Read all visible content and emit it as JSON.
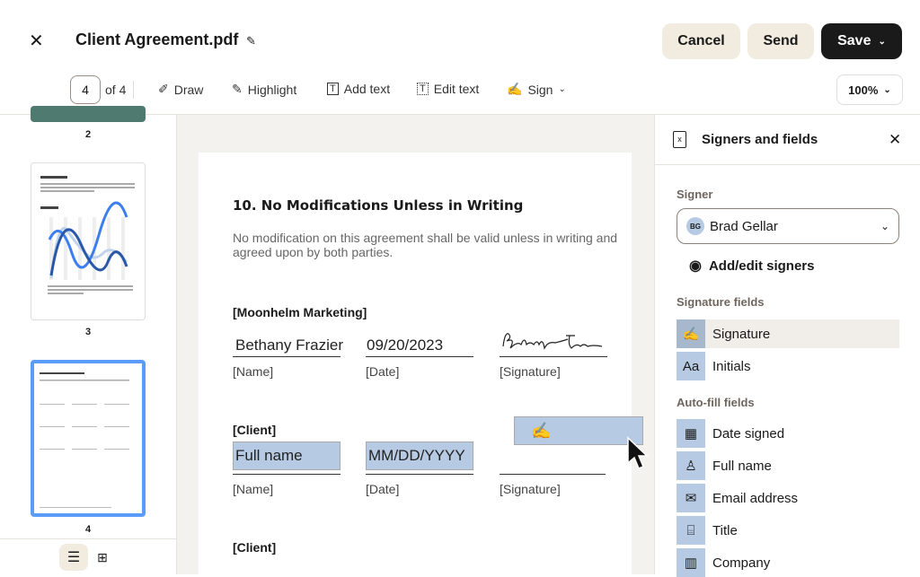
{
  "header": {
    "title": "Client Agreement.pdf",
    "cancel": "Cancel",
    "send": "Send",
    "save": "Save"
  },
  "toolbar": {
    "page": "4",
    "of": "of 4",
    "draw": "Draw",
    "highlight": "Highlight",
    "add_text": "Add text",
    "edit_text": "Edit text",
    "sign": "Sign",
    "zoom": "100%"
  },
  "thumbnails": {
    "labels": [
      "2",
      "3",
      "4"
    ],
    "current": "4"
  },
  "document": {
    "heading": "10. No Modifications Unless in Writing",
    "body": "No modification on this agreement shall be valid unless in writing and agreed upon by both parties.",
    "party1": "[Moonhelm Marketing]",
    "name1": "Bethany Frazier",
    "date1": "09/20/2023",
    "party2": "[Client]",
    "name_field": "Full name",
    "date_field": "MM/DD/YYYY",
    "party3": "[Client]",
    "name_label": "[Name]",
    "date_label": "[Date]",
    "sig_label": "[Signature]"
  },
  "panel": {
    "title": "Signers and fields",
    "signer_label": "Signer",
    "signer_initials": "BG",
    "signer_name": "Brad Gellar",
    "add_edit": "Add/edit signers",
    "sig_section": "Signature fields",
    "sig_fields": [
      "Signature",
      "Initials"
    ],
    "auto_section": "Auto-fill fields",
    "auto_fields": [
      "Date signed",
      "Full name",
      "Email address",
      "Title",
      "Company"
    ]
  },
  "colors": {
    "field": "#b7cae3",
    "accent": "#5b9cf8",
    "dark": "#1a1a1a",
    "beige": "#f1ebe0"
  }
}
